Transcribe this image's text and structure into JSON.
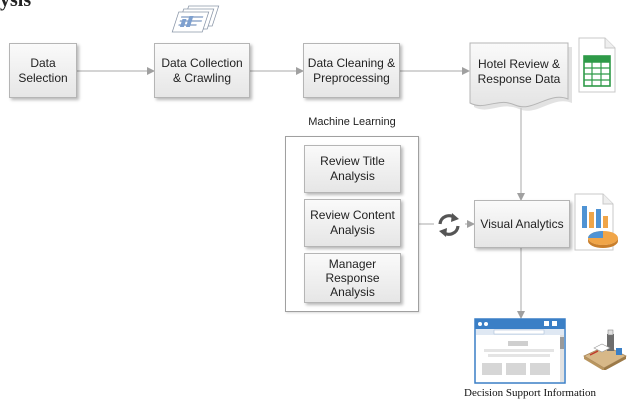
{
  "partial_title": "ysis",
  "nodes": {
    "data_selection": "Data\nSelection",
    "data_collection": "Data Collection\n& Crawling",
    "data_cleaning": "Data Cleaning &\nPreprocessing",
    "hotel_data": "Hotel Review &\nResponse Data",
    "visual_analytics": "Visual Analytics"
  },
  "machine_learning": {
    "title": "Machine Learning",
    "items": [
      "Review Title\nAnalysis",
      "Review Content\nAnalysis",
      "Manager\nResponse\nAnalysis"
    ]
  },
  "output_label": "Decision Support Information",
  "icons": [
    "documents-stack-icon",
    "spreadsheet-icon",
    "bar-chart-pie-icon",
    "refresh-cycle-icon",
    "browser-window-icon",
    "desk-tools-icon"
  ],
  "colors": {
    "spreadsheet_green": "#2e9a48",
    "bar_blue": "#4f93d4",
    "bar_orange": "#f0a548",
    "browser_blue": "#3a7fc6",
    "line": "#a9a9a9"
  }
}
